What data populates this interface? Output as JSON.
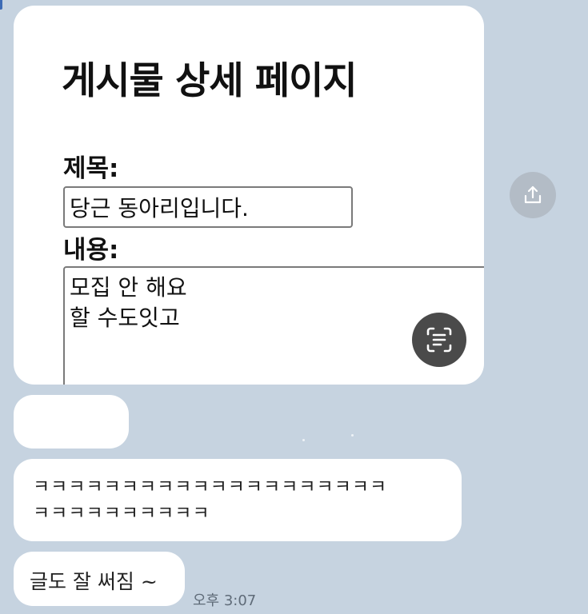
{
  "chat": {
    "image_message": {
      "page_title": "게시물 상세 페이지",
      "title_label": "제목:",
      "title_value": "당근 동아리입니다.",
      "content_label": "내용:",
      "content_lines": [
        "모집 안 해요",
        "할 수도잇고"
      ]
    },
    "messages": [
      {
        "text": ""
      },
      {
        "lines": [
          "ㅋㅋㅋㅋㅋㅋㅋㅋㅋㅋㅋㅋㅋㅋㅋㅋㅋㅋㅋㅋ",
          "ㅋㅋㅋㅋㅋㅋㅋㅋㅋㅋ"
        ]
      },
      {
        "text": "글도 잘 써짐 ~"
      }
    ],
    "timestamp": "오후 3:07"
  },
  "icons": {
    "share": "share-icon",
    "text_scan": "text-scan-icon"
  },
  "colors": {
    "background": "#c6d3e0",
    "bubble": "#ffffff",
    "scan_button": "#4a4a4a",
    "share_button": "#b3bcc6"
  }
}
